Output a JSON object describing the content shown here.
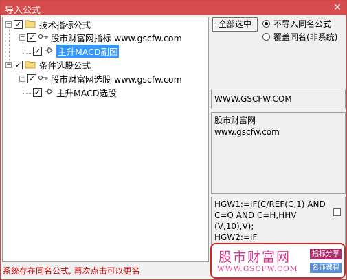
{
  "window": {
    "title": "导入公式",
    "close_glyph": "✕"
  },
  "tree": {
    "nodes": [
      {
        "label": "技术指标公式",
        "checked": true,
        "expanded": true
      },
      {
        "label": "股市财富网指标-www.gscfw.com",
        "checked": true,
        "expanded": true
      },
      {
        "label": "主升MACD副图",
        "checked": true,
        "selected": true
      },
      {
        "label": "条件选股公式",
        "checked": true,
        "expanded": true
      },
      {
        "label": "股市财富网选股-www.gscfw.com",
        "checked": true,
        "expanded": true
      },
      {
        "label": "主升MACD选股",
        "checked": true
      }
    ],
    "expand_glyph": "−",
    "check_glyph": "✓"
  },
  "options": {
    "select_all_label": "全部选中",
    "radio_no_import": "不导入同名公式",
    "radio_overwrite": "覆盖同名(非系统)",
    "selected_radio": "no_import"
  },
  "info": {
    "url_box": "WWW.GSCFW.COM",
    "desc_line1": "股市财富网",
    "desc_line2": "www.gscfw.com"
  },
  "code": {
    "lines": [
      "HGW1:=IF(C/REF(C,1) AND",
      "C=O AND C=H,HHV",
      "(V,10),V);",
      "HGW2:=IF"
    ]
  },
  "status": {
    "message": "系统存在同名公式, 再次点击可以更名"
  },
  "watermark": {
    "brand": "股市财富网",
    "url": "WWW.GSCFW.COM",
    "tag1": "指标分享",
    "tag2": "名师课程"
  },
  "colors": {
    "titlebar": "#d64b4b",
    "status_text": "#d00000",
    "selection": "#3399ff",
    "watermark_border": "#dd2222",
    "watermark_text": "#d93b8e"
  }
}
